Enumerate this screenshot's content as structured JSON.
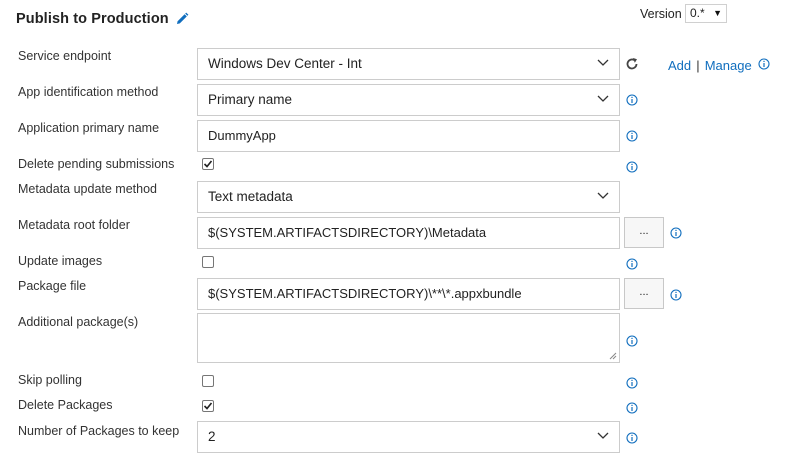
{
  "header": {
    "title": "Publish to Production",
    "version_label": "Version",
    "version_value": "0.*"
  },
  "service_endpoint": {
    "label": "Service endpoint",
    "value": "Windows Dev Center - Int",
    "add_label": "Add",
    "separator": "|",
    "manage_label": "Manage"
  },
  "app_id_method": {
    "label": "App identification method",
    "value": "Primary name"
  },
  "app_primary_name": {
    "label": "Application primary name",
    "value": "DummyApp"
  },
  "delete_pending": {
    "label": "Delete pending submissions",
    "checked": true
  },
  "metadata_method": {
    "label": "Metadata update method",
    "value": "Text metadata"
  },
  "metadata_root": {
    "label": "Metadata root folder",
    "value": "$(SYSTEM.ARTIFACTSDIRECTORY)\\Metadata",
    "browse_label": "..."
  },
  "update_images": {
    "label": "Update images",
    "checked": false
  },
  "package_file": {
    "label": "Package file",
    "value": "$(SYSTEM.ARTIFACTSDIRECTORY)\\**\\*.appxbundle",
    "browse_label": "..."
  },
  "additional_packages": {
    "label": "Additional package(s)",
    "value": ""
  },
  "skip_polling": {
    "label": "Skip polling",
    "checked": false
  },
  "delete_packages": {
    "label": "Delete Packages",
    "checked": true
  },
  "packages_to_keep": {
    "label": "Number of Packages to keep",
    "value": "2"
  },
  "colors": {
    "link": "#106ebe",
    "info": "#106ebe",
    "border": "#cccccc"
  }
}
